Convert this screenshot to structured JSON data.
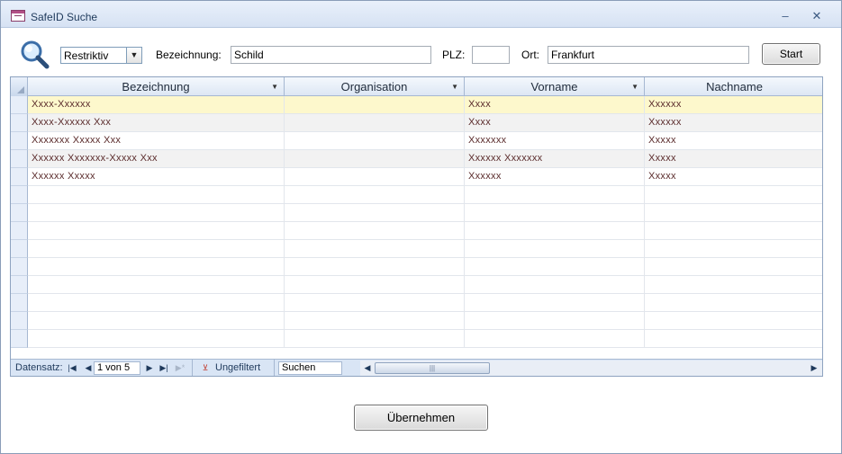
{
  "window": {
    "title": "SafeID Suche"
  },
  "search": {
    "mode": "Restriktiv",
    "bezeichnung_label": "Bezeichnung:",
    "bezeichnung_value": "Schild",
    "plz_label": "PLZ:",
    "plz_value": "",
    "ort_label": "Ort:",
    "ort_value": "Frankfurt",
    "start_label": "Start"
  },
  "grid": {
    "columns": [
      "Bezeichnung",
      "Organisation",
      "Vorname",
      "Nachname"
    ],
    "rows": [
      [
        "Xxxx-Xxxxxx",
        "",
        "Xxxx",
        "Xxxxxx"
      ],
      [
        "Xxxx-Xxxxxx  Xxx",
        "",
        "Xxxx",
        "Xxxxxx"
      ],
      [
        "Xxxxxxx Xxxxx  Xxx",
        "",
        "Xxxxxxx",
        "Xxxxx"
      ],
      [
        "Xxxxxx Xxxxxxx-Xxxxx  Xxx",
        "",
        "Xxxxxx Xxxxxxx",
        "Xxxxx"
      ],
      [
        "Xxxxxx Xxxxx",
        "",
        "Xxxxxx",
        "Xxxxx"
      ]
    ],
    "selected_row": 0
  },
  "navigation": {
    "label": "Datensatz:",
    "position": "1 von 5",
    "filter_label": "Ungefiltert",
    "search_label": "Suchen"
  },
  "footer": {
    "accept_label": "Übernehmen"
  },
  "colors": {
    "titlebar_text": "#1e395b",
    "selected_row_bg": "#fdf8cc",
    "alt_row_bg": "#f2f2f2",
    "nav_bg": "#d9e5f5"
  }
}
